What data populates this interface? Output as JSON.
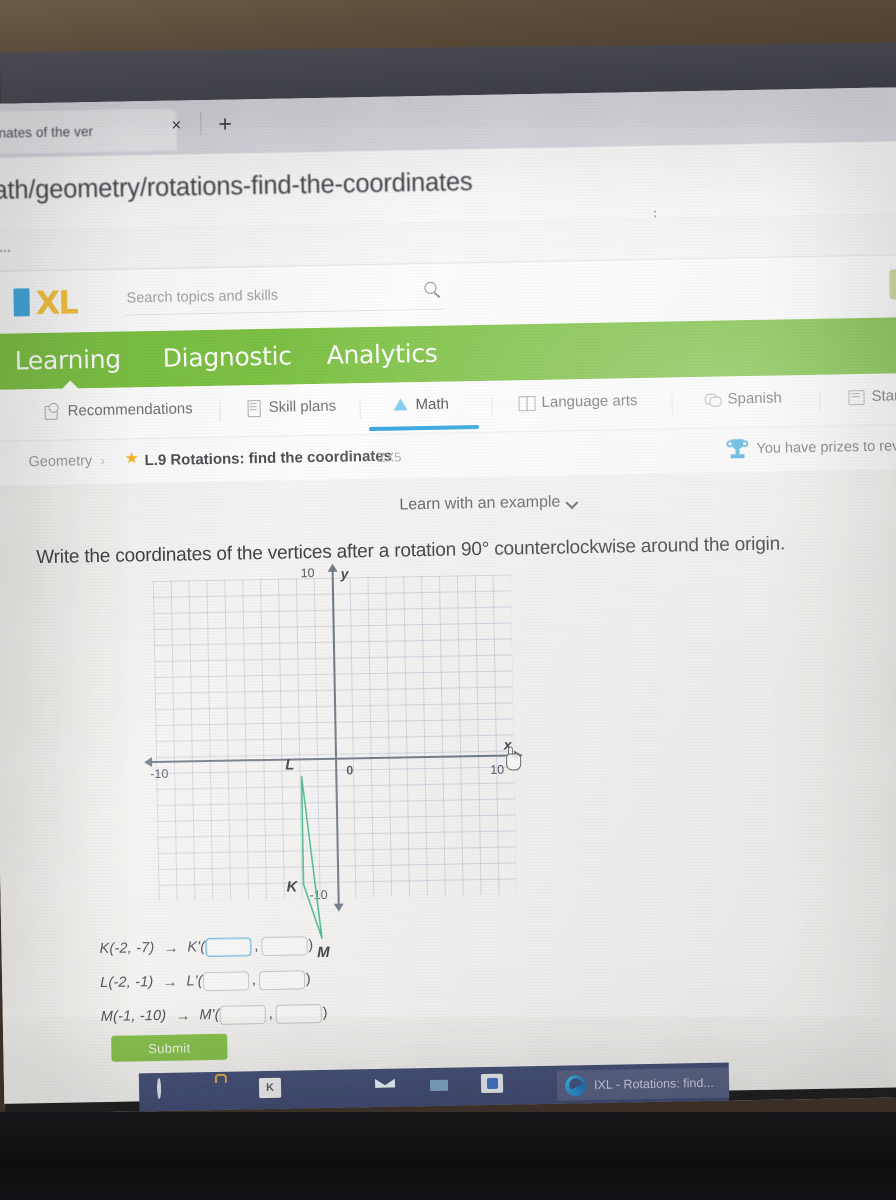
{
  "browser": {
    "tab_title": "nates of the ver",
    "tab_close_glyph": "×",
    "new_tab_glyph": "+",
    "url": "/math/geometry/rotations-find-the-coordinates",
    "url_menu_dots": "⋮",
    "bookmark_label": "urse..."
  },
  "site_header": {
    "logo_letters": "XL",
    "search_placeholder": "Search topics and skills",
    "search_value": ""
  },
  "green_nav": {
    "items": [
      {
        "label": "Learning",
        "active": true
      },
      {
        "label": "Diagnostic",
        "active": false
      },
      {
        "label": "Analytics",
        "active": false
      }
    ]
  },
  "subject_tabs": {
    "items": [
      {
        "label": "Recommendations",
        "icon": "recommendations-icon",
        "active": false
      },
      {
        "label": "Skill plans",
        "icon": "skill-plans-icon",
        "active": false
      },
      {
        "label": "Math",
        "icon": "math-icon",
        "active": true
      },
      {
        "label": "Language arts",
        "icon": "language-arts-icon",
        "active": false
      },
      {
        "label": "Spanish",
        "icon": "spanish-icon",
        "active": false
      },
      {
        "label": "Star",
        "icon": "standards-icon",
        "active": false
      }
    ],
    "active_accent": "#2aa2dd"
  },
  "breadcrumb": {
    "subject": "Geometry",
    "separator": "›",
    "star_glyph": "★",
    "skill": "L.9 Rotations: find the coordinates",
    "skill_code": "ZX5"
  },
  "prizes": {
    "icon": "trophy-icon",
    "text": "You have prizes to reve"
  },
  "question": {
    "learn_link": "Learn with an example",
    "prompt": "Write the coordinates of the vertices after a rotation 90° counterclockwise around the origin."
  },
  "chart_data": {
    "type": "scatter",
    "title": "",
    "xlabel": "x",
    "ylabel": "y",
    "xlim": [
      -10,
      10
    ],
    "ylim": [
      -10,
      10
    ],
    "grid": true,
    "tick_labels": {
      "x_negative": "-10",
      "x_positive": "10",
      "y_positive": "10",
      "y_negative": "-10",
      "origin": "0"
    },
    "series": [
      {
        "name": "triangle KLM",
        "color": "#4bbf8a",
        "closed": true,
        "points": [
          {
            "label": "K",
            "x": -2,
            "y": -7
          },
          {
            "label": "L",
            "x": -2,
            "y": -1
          },
          {
            "label": "M",
            "x": -1,
            "y": -10
          }
        ]
      }
    ],
    "cursor": {
      "icon": "hand-cursor",
      "x": 10,
      "y": 0
    }
  },
  "answers": {
    "rows": [
      {
        "source": "K(-2, -7)",
        "arrow": "→",
        "image_label": "K'(",
        "x_value": "",
        "y_value": "",
        "close_paren": ")",
        "comma": ",",
        "focused": true
      },
      {
        "source": "L(-2, -1)",
        "arrow": "→",
        "image_label": "L'(",
        "x_value": "",
        "y_value": "",
        "close_paren": ")",
        "comma": ",",
        "focused": false
      },
      {
        "source": "M(-1, -10)",
        "arrow": "→",
        "image_label": "M'(",
        "x_value": "",
        "y_value": "",
        "close_paren": ")",
        "comma": ",",
        "focused": false
      }
    ],
    "submit_label": "Submit",
    "submit_color": "#86c24a"
  },
  "taskbar": {
    "icons": [
      "cortana-icon",
      "store-icon",
      "k-app-icon",
      "mail-icon",
      "file-explorer-icon",
      "blue-app-icon"
    ],
    "active_window": {
      "icon": "edge-icon",
      "title": "IXL - Rotations: find..."
    }
  }
}
